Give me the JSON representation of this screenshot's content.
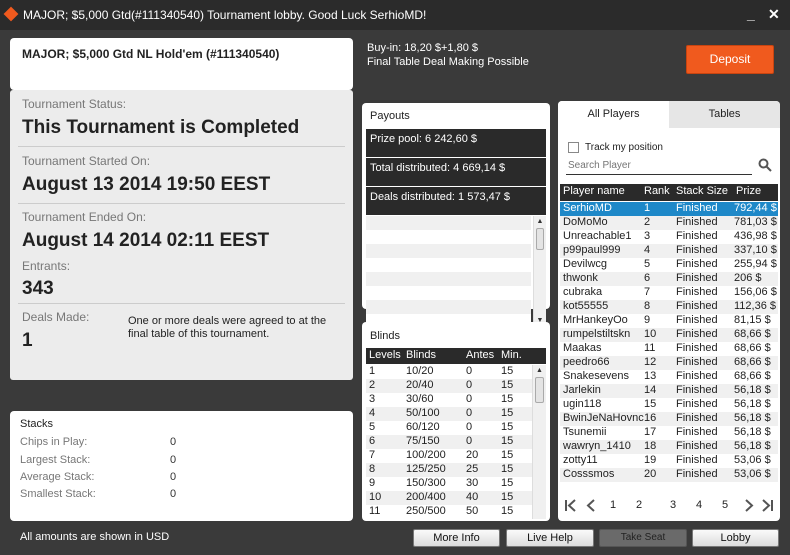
{
  "window": {
    "title": "MAJOR; $5,000 Gtd(#111340540) Tournament lobby. Good Luck SerhioMD!",
    "minimize": "_",
    "close": "✕"
  },
  "tournament": {
    "name": "MAJOR; $5,000 Gtd NL Hold'em (#111340540)",
    "buyin": "Buy-in: 18,20 $+1,80 $",
    "note": "Final Table Deal Making Possible",
    "deposit_label": "Deposit"
  },
  "status": {
    "status_label": "Tournament Status:",
    "status_value": "This Tournament is Completed",
    "started_label": "Tournament Started On:",
    "started_value": "August 13 2014  19:50 EEST",
    "ended_label": "Tournament Ended On:",
    "ended_value": "August 14 2014  02:11 EEST",
    "entrants_label": "Entrants:",
    "entrants_value": "343",
    "deals_label": "Deals Made:",
    "deals_value": "1",
    "deals_note": "One or more deals were agreed to at the final table of this tournament."
  },
  "stacks": {
    "title": "Stacks",
    "rows": [
      {
        "label": "Chips in Play:",
        "value": "0"
      },
      {
        "label": "Largest Stack:",
        "value": "0"
      },
      {
        "label": "Average Stack:",
        "value": "0"
      },
      {
        "label": "Smallest Stack:",
        "value": "0"
      }
    ]
  },
  "payouts": {
    "title": "Payouts",
    "prize_pool": "Prize pool: 6 242,60 $",
    "total_distributed": "Total distributed: 4 669,14 $",
    "deals_distributed": "Deals distributed: 1 573,47 $"
  },
  "blinds": {
    "title": "Blinds",
    "headers": [
      "Levels",
      "Blinds",
      "Antes",
      "Min."
    ],
    "rows": [
      [
        "1",
        "10/20",
        "0",
        "15"
      ],
      [
        "2",
        "20/40",
        "0",
        "15"
      ],
      [
        "3",
        "30/60",
        "0",
        "15"
      ],
      [
        "4",
        "50/100",
        "0",
        "15"
      ],
      [
        "5",
        "60/120",
        "0",
        "15"
      ],
      [
        "6",
        "75/150",
        "0",
        "15"
      ],
      [
        "7",
        "100/200",
        "20",
        "15"
      ],
      [
        "8",
        "125/250",
        "25",
        "15"
      ],
      [
        "9",
        "150/300",
        "30",
        "15"
      ],
      [
        "10",
        "200/400",
        "40",
        "15"
      ],
      [
        "11",
        "250/500",
        "50",
        "15"
      ]
    ]
  },
  "players": {
    "tab_all": "All Players",
    "tab_tables": "Tables",
    "track_label": "Track my position",
    "search_placeholder": "Search Player",
    "headers": [
      "Player name",
      "Rank",
      "Stack Size",
      "Prize"
    ],
    "rows": [
      [
        "SerhioMD",
        "1",
        "Finished",
        "792,44 $"
      ],
      [
        "DoMoMo",
        "2",
        "Finished",
        "781,03 $"
      ],
      [
        "Unreachable1",
        "3",
        "Finished",
        "436,98 $"
      ],
      [
        "p99paul999",
        "4",
        "Finished",
        "337,10 $"
      ],
      [
        "Devilwcg",
        "5",
        "Finished",
        "255,94 $"
      ],
      [
        "thwonk",
        "6",
        "Finished",
        "206 $"
      ],
      [
        "cubraka",
        "7",
        "Finished",
        "156,06 $"
      ],
      [
        "kot55555",
        "8",
        "Finished",
        "112,36 $"
      ],
      [
        "MrHankeyOo",
        "9",
        "Finished",
        "81,15 $"
      ],
      [
        "rumpelstiltskn",
        "10",
        "Finished",
        "68,66 $"
      ],
      [
        "Maakas",
        "11",
        "Finished",
        "68,66 $"
      ],
      [
        "peedro66",
        "12",
        "Finished",
        "68,66 $"
      ],
      [
        "Snakesevens",
        "13",
        "Finished",
        "68,66 $"
      ],
      [
        "Jarlekin",
        "14",
        "Finished",
        "56,18 $"
      ],
      [
        "ugin118",
        "15",
        "Finished",
        "56,18 $"
      ],
      [
        "BwinJeNaHovnc",
        "16",
        "Finished",
        "56,18 $"
      ],
      [
        "Tsunemii",
        "17",
        "Finished",
        "56,18 $"
      ],
      [
        "wawryn_1410",
        "18",
        "Finished",
        "56,18 $"
      ],
      [
        "zotty11",
        "19",
        "Finished",
        "53,06 $"
      ],
      [
        "Cosssmos",
        "20",
        "Finished",
        "53,06 $"
      ]
    ],
    "pages": [
      "1",
      "2",
      "3",
      "4",
      "5"
    ]
  },
  "footer": {
    "note": "All amounts are shown in USD",
    "more_info": "More Info",
    "live_help": "Live Help",
    "take_seat": "Take Seat",
    "lobby": "Lobby"
  },
  "colors": {
    "accent": "#f05a1e",
    "selected_row": "#1e88c8",
    "header": "#2a2a2a"
  }
}
